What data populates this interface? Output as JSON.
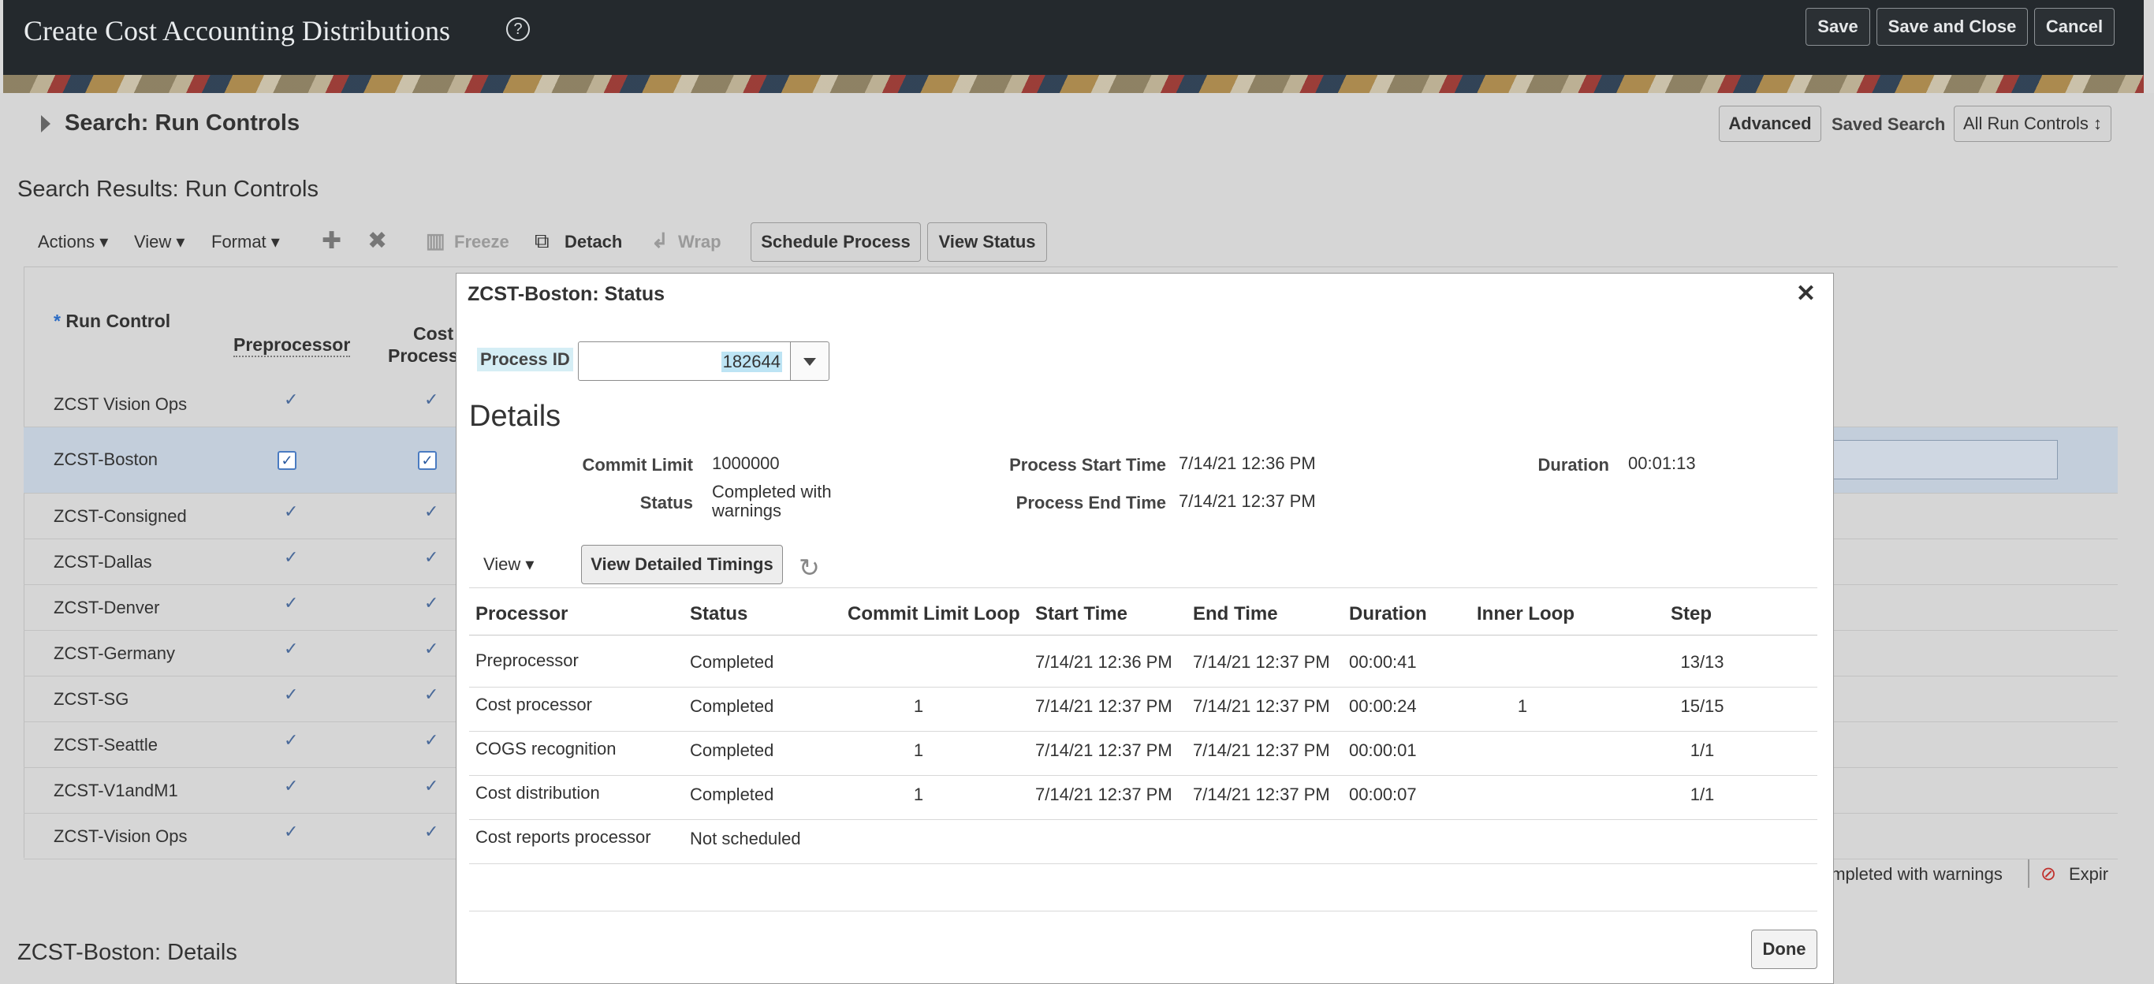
{
  "header": {
    "title": "Create Cost Accounting Distributions",
    "help": "?",
    "save": "Save",
    "save_close": "Save and Close",
    "cancel": "Cancel"
  },
  "search": {
    "title": "Search: Run Controls",
    "advanced": "Advanced",
    "saved_search_label": "Saved Search",
    "saved_search_value": "All Run Controls ↕"
  },
  "results": {
    "title": "Search Results: Run Controls",
    "toolbar": {
      "actions": "Actions ▾",
      "view": "View ▾",
      "format": "Format ▾",
      "add": "✚",
      "delete": "✖",
      "freeze": "Freeze",
      "detach": "Detach",
      "wrap": "Wrap",
      "schedule": "Schedule Process",
      "view_status": "View Status"
    },
    "columns": {
      "run_control": "Run Control",
      "preprocessor": "Preprocessor",
      "cost_processor_l1": "Cost",
      "cost_processor_l2": "Process"
    },
    "rows": [
      {
        "name": "ZCST Vision Ops"
      },
      {
        "name": "ZCST-Boston"
      },
      {
        "name": "ZCST-Consigned"
      },
      {
        "name": "ZCST-Dallas"
      },
      {
        "name": "ZCST-Denver"
      },
      {
        "name": "ZCST-Germany"
      },
      {
        "name": "ZCST-SG"
      },
      {
        "name": "ZCST-Seattle"
      },
      {
        "name": "ZCST-V1andM1"
      },
      {
        "name": "ZCST-Vision Ops"
      }
    ],
    "tick": "✓",
    "legend_completed_warnings": "ompleted with warnings",
    "legend_expired": "Expir"
  },
  "details_title": "ZCST-Boston: Details",
  "modal": {
    "title": "ZCST-Boston: Status",
    "close": "✕",
    "process_id_label": "Process ID",
    "process_id_value": "182644",
    "section": "Details",
    "commit_limit_label": "Commit Limit",
    "commit_limit_value": "1000000",
    "status_label": "Status",
    "status_value_l1": "Completed with",
    "status_value_l2": "warnings",
    "start_label": "Process Start Time",
    "start_value": "7/14/21 12:36 PM",
    "end_label": "Process End Time",
    "end_value": "7/14/21 12:37 PM",
    "duration_label": "Duration",
    "duration_value": "00:01:13",
    "view_menu": "View ▾",
    "view_timings": "View Detailed Timings",
    "refresh": "↻",
    "table": {
      "headers": [
        "Processor",
        "Status",
        "Commit Limit Loop",
        "Start Time",
        "End Time",
        "Duration",
        "Inner Loop",
        "Step"
      ],
      "rows": [
        {
          "processor": "Preprocessor",
          "status": "Completed",
          "loop": "",
          "start": "7/14/21 12:36 PM",
          "end": "7/14/21 12:37 PM",
          "duration": "00:00:41",
          "inner": "",
          "step": "13/13"
        },
        {
          "processor": "Cost processor",
          "status": "Completed",
          "loop": "1",
          "start": "7/14/21 12:37 PM",
          "end": "7/14/21 12:37 PM",
          "duration": "00:00:24",
          "inner": "1",
          "step": "15/15"
        },
        {
          "processor": "COGS recognition",
          "status": "Completed",
          "loop": "1",
          "start": "7/14/21 12:37 PM",
          "end": "7/14/21 12:37 PM",
          "duration": "00:00:01",
          "inner": "",
          "step": "1/1"
        },
        {
          "processor": "Cost distribution",
          "status": "Completed",
          "loop": "1",
          "start": "7/14/21 12:37 PM",
          "end": "7/14/21 12:37 PM",
          "duration": "00:00:07",
          "inner": "",
          "step": "1/1"
        },
        {
          "processor": "Cost reports processor",
          "status": "Not scheduled",
          "loop": "",
          "start": "",
          "end": "",
          "duration": "",
          "inner": "",
          "step": ""
        }
      ]
    },
    "done": "Done"
  }
}
